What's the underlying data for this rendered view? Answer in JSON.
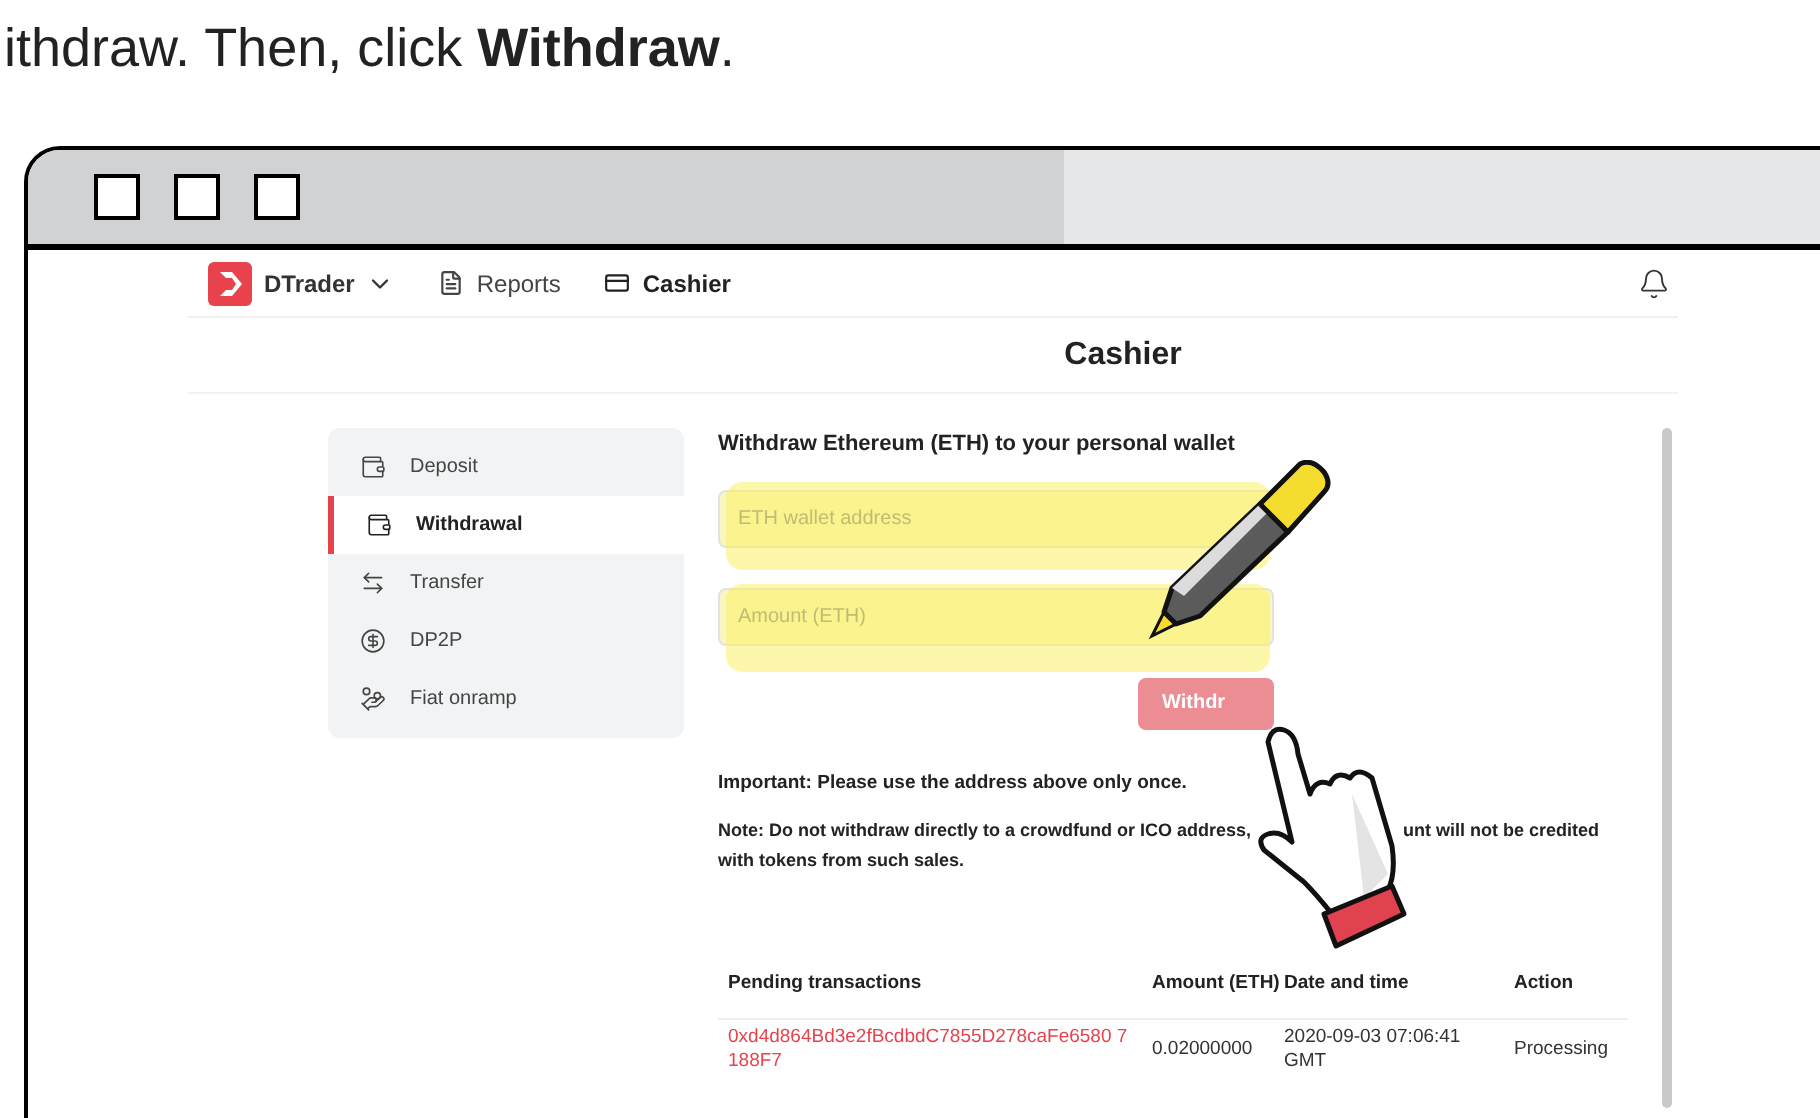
{
  "caption": "ithdraw. Then, click **Withdraw**.",
  "nav": {
    "brand": "DTrader",
    "items": [
      {
        "label": "Reports",
        "selected": false
      },
      {
        "label": "Cashier",
        "selected": true
      }
    ]
  },
  "page_title": "Cashier",
  "sidebar": {
    "items": [
      {
        "label": "Deposit",
        "selected": false
      },
      {
        "label": "Withdrawal",
        "selected": true
      },
      {
        "label": "Transfer",
        "selected": false
      },
      {
        "label": "DP2P",
        "selected": false
      },
      {
        "label": "Fiat onramp",
        "selected": false
      }
    ]
  },
  "form": {
    "heading": "Withdraw Ethereum (ETH) to your personal wallet",
    "fields": [
      {
        "placeholder": "ETH wallet address"
      },
      {
        "placeholder": "Amount (ETH)"
      }
    ],
    "button": {
      "label": "Withdr",
      "disabled": true
    },
    "important": "Important: Please use the address above only once.",
    "note": {
      "before": "Note: Do not withdraw directly to a crowdfund or ICO address,",
      "after": "unt will not be credited",
      "line_2": "with tokens from such sales."
    }
  },
  "table": {
    "columns": [
      "Pending transactions",
      "Amount (ETH)",
      "Date and time",
      "Action"
    ],
    "rows": [
      {
        "cells": [
          "0xd4d864Bd3e2fBcdbdC7855D278caFe6580 7188F7",
          "0.02000000",
          "2020-09-03 07:06:41 GMT",
          "Processing"
        ]
      }
    ]
  }
}
